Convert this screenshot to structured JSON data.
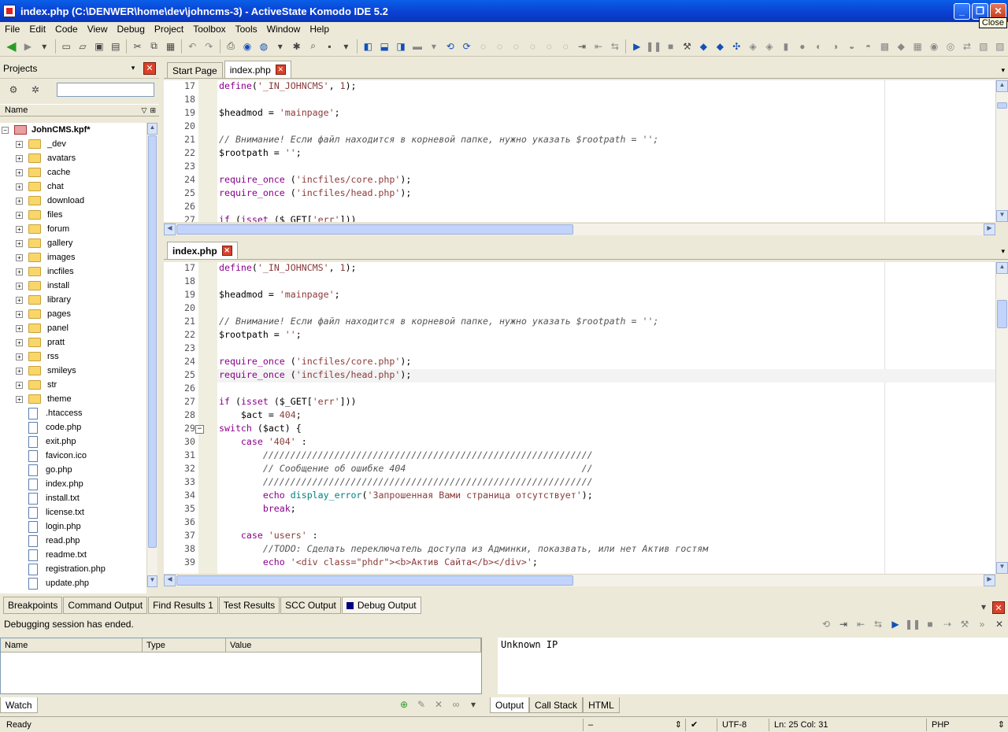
{
  "window": {
    "title": "index.php (C:\\DENWER\\home\\dev\\johncms-3) - ActiveState Komodo IDE 5.2",
    "tooltip": "Close"
  },
  "menu": [
    "File",
    "Edit",
    "Code",
    "View",
    "Debug",
    "Project",
    "Toolbox",
    "Tools",
    "Window",
    "Help"
  ],
  "projects": {
    "title": "Projects",
    "column": "Name",
    "root": "JohnCMS.kpf*",
    "folders": [
      "_dev",
      "avatars",
      "cache",
      "chat",
      "download",
      "files",
      "forum",
      "gallery",
      "images",
      "incfiles",
      "install",
      "library",
      "pages",
      "panel",
      "pratt",
      "rss",
      "smileys",
      "str",
      "theme"
    ],
    "files": [
      ".htaccess",
      "code.php",
      "exit.php",
      "favicon.ico",
      "go.php",
      "index.php",
      "install.txt",
      "license.txt",
      "login.php",
      "read.php",
      "readme.txt",
      "registration.php",
      "update.php"
    ]
  },
  "editor_top": {
    "tabs": [
      "Start Page",
      "index.php"
    ],
    "lines": [
      {
        "n": "17",
        "html": "<span class='kw'>define</span>(<span class='st'>'_IN_JOHNCMS'</span>, <span class='nm'>1</span>);"
      },
      {
        "n": "18",
        "html": ""
      },
      {
        "n": "19",
        "html": "$headmod = <span class='st'>'mainpage'</span>;"
      },
      {
        "n": "20",
        "html": ""
      },
      {
        "n": "21",
        "html": "<span class='cm'>// Внимание! Если файл находится в корневой папке, нужно указать $rootpath = '';</span>"
      },
      {
        "n": "22",
        "html": "$rootpath = <span class='st'>''</span>;"
      },
      {
        "n": "23",
        "html": ""
      },
      {
        "n": "24",
        "html": "<span class='kw'>require_once</span> (<span class='st'>'incfiles/core.php'</span>);"
      },
      {
        "n": "25",
        "html": "<span class='kw'>require_once</span> (<span class='st'>'incfiles/head.php'</span>);"
      },
      {
        "n": "26",
        "html": ""
      },
      {
        "n": "27",
        "html": "<span class='kw'>if</span> (<span class='kw'>isset</span> ($_GET[<span class='st'>'err'</span>]))"
      }
    ]
  },
  "editor_bottom": {
    "tab": "index.php",
    "lines": [
      {
        "n": "17",
        "html": "<span class='kw'>define</span>(<span class='st'>'_IN_JOHNCMS'</span>, <span class='nm'>1</span>);"
      },
      {
        "n": "18",
        "html": ""
      },
      {
        "n": "19",
        "html": "$headmod = <span class='st'>'mainpage'</span>;"
      },
      {
        "n": "20",
        "html": ""
      },
      {
        "n": "21",
        "html": "<span class='cm'>// Внимание! Если файл находится в корневой папке, нужно указать $rootpath = '';</span>"
      },
      {
        "n": "22",
        "html": "$rootpath = <span class='st'>''</span>;"
      },
      {
        "n": "23",
        "html": ""
      },
      {
        "n": "24",
        "html": "<span class='kw'>require_once</span> (<span class='st'>'incfiles/core.php'</span>);"
      },
      {
        "n": "25",
        "html": "<span class='kw'>require_once</span> (<span class='st'>'incfiles/head.php'</span>);"
      },
      {
        "n": "26",
        "html": ""
      },
      {
        "n": "27",
        "html": "<span class='kw'>if</span> (<span class='kw'>isset</span> ($_GET[<span class='st'>'err'</span>]))"
      },
      {
        "n": "28",
        "html": "    $act = <span class='nm'>404</span>;"
      },
      {
        "n": "29",
        "html": "<span class='kw'>switch</span> ($act) {"
      },
      {
        "n": "30",
        "html": "    <span class='kw'>case</span> <span class='st'>'404'</span> :"
      },
      {
        "n": "31",
        "html": "        <span class='cm'>////////////////////////////////////////////////////////////</span>"
      },
      {
        "n": "32",
        "html": "        <span class='cm'>// Сообщение об ошибке 404                                //</span>"
      },
      {
        "n": "33",
        "html": "        <span class='cm'>////////////////////////////////////////////////////////////</span>"
      },
      {
        "n": "34",
        "html": "        <span class='kw'>echo</span> <span class='fn'>display_error</span>(<span class='st'>'Запрошенная Вами страница отсутствует'</span>);"
      },
      {
        "n": "35",
        "html": "        <span class='kw'>break</span>;"
      },
      {
        "n": "36",
        "html": ""
      },
      {
        "n": "37",
        "html": "    <span class='kw'>case</span> <span class='st'>'users'</span> :"
      },
      {
        "n": "38",
        "html": "        <span class='cm'>//TODO: Сделать переключатель доступа из Админки, показвать, или нет Актив гостям</span>"
      },
      {
        "n": "39",
        "html": "        <span class='kw'>echo</span> <span class='st'>'&lt;div class=\"phdr\"&gt;&lt;b&gt;Актив Сайта&lt;/b&gt;&lt;/div&gt;'</span>;"
      }
    ]
  },
  "bottom_tabs": [
    "Breakpoints",
    "Command Output",
    "Find Results 1",
    "Test Results",
    "SCC Output",
    "Debug Output"
  ],
  "debug": {
    "status": "Debugging session has ended.",
    "columns": [
      "Name",
      "Type",
      "Value"
    ],
    "output": "Unknown IP",
    "left_tab": "Watch",
    "right_tabs": [
      "Output",
      "Call Stack",
      "HTML"
    ]
  },
  "statusbar": {
    "state": "Ready",
    "dash": "–",
    "encoding": "UTF-8",
    "position": "Ln: 25 Col: 31",
    "language": "PHP"
  }
}
